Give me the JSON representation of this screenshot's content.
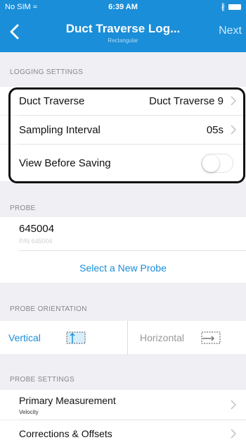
{
  "status_bar": {
    "carrier": "No SIM ≈",
    "time": "6:39 AM",
    "bluetooth": "∦"
  },
  "nav": {
    "back_icon": "chevron-left-icon",
    "title": "Duct Traverse Log...",
    "subtitle": "Rectangular",
    "next_label": "Next"
  },
  "logging_settings": {
    "header": "LOGGING SETTINGS",
    "rows": [
      {
        "label": "Duct Traverse",
        "value": "Duct Traverse 9"
      },
      {
        "label": "Sampling Interval",
        "value": "05s"
      }
    ],
    "view_before_saving": {
      "label": "View Before Saving",
      "on": false
    }
  },
  "probe": {
    "header": "PROBE",
    "id": "645004",
    "serial": "P/N 645004",
    "select_label": "Select a New Probe"
  },
  "probe_orientation": {
    "header": "PROBE ORIENTATION",
    "options": [
      {
        "label": "Vertical",
        "selected": true
      },
      {
        "label": "Horizontal",
        "selected": false
      }
    ]
  },
  "probe_settings": {
    "header": "PROBE SETTINGS",
    "primary_measurement": {
      "title": "Primary Measurement",
      "value": "Velocity"
    },
    "corrections": {
      "title": "Corrections & Offsets"
    }
  },
  "colors": {
    "accent": "#1a8ed8",
    "background": "#efeff4"
  }
}
